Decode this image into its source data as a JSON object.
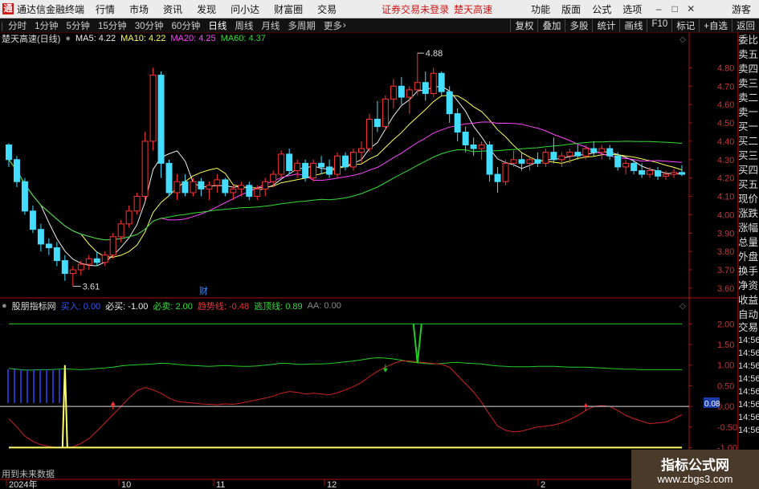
{
  "app": {
    "name": "通达信金融终端",
    "menus": [
      "行情",
      "市场",
      "资讯",
      "发现",
      "问小达",
      "财富圈",
      "交易"
    ],
    "warning": "证券交易未登录",
    "warning2": "楚天高速",
    "functions": [
      "功能",
      "版面",
      "公式",
      "选项"
    ],
    "guest": "游客"
  },
  "periods": [
    "分时",
    "1分钟",
    "5分钟",
    "15分钟",
    "30分钟",
    "60分钟",
    "日线",
    "周线",
    "月线",
    "多周期",
    "更多"
  ],
  "active_period": "日线",
  "tools": [
    "复权",
    "叠加",
    "多股",
    "统计",
    "画线",
    "F10",
    "标记",
    "+自选",
    "返回"
  ],
  "main": {
    "stock_title": "楚天高速(日线)",
    "ma5": "MA5: 4.22",
    "ma10": "MA10: 4.22",
    "ma20": "MA20: 4.25",
    "ma60": "MA60: 4.37",
    "high_label": "4.88",
    "low_label": "3.61",
    "event_label": "财"
  },
  "indicator": {
    "name": "股朋指标网",
    "buy": "买入: 0.00",
    "must_buy": "必买: -1.00",
    "must_sell": "必卖: 2.00",
    "trend": "趋势线: -0.48",
    "escape": "逃顶线: 0.89",
    "aa": "AA: 0.00",
    "cursor_value": "0.08"
  },
  "right_panel": [
    "委比",
    "卖五",
    "卖四",
    "卖三",
    "卖二",
    "卖一",
    "买一",
    "买二",
    "买三",
    "买四",
    "买五",
    "现价",
    "涨跌",
    "涨幅",
    "总量",
    "外盘",
    "换手",
    "净资",
    "收益"
  ],
  "right_panel_lower": [
    "自动",
    "交易",
    "14:56",
    "14:56",
    "14:56",
    "14:56",
    "14:56",
    "14:56",
    "14:56",
    "14:56"
  ],
  "bottom_note": "用到未来数据",
  "watermark": {
    "line1": "指标公式网",
    "line2": "www.zbgs3.com"
  },
  "chart_data": [
    {
      "type": "candlestick",
      "title": "楚天高速(日线)",
      "y_ticks": [
        "4.80",
        "4.70",
        "4.60",
        "4.50",
        "4.40",
        "4.30",
        "4.20",
        "4.10",
        "4.00",
        "3.90",
        "3.80",
        "3.70",
        "3.60"
      ],
      "ylim": [
        3.56,
        4.92
      ],
      "x_ticks": [
        "2024年",
        "10",
        "11",
        "12",
        "2"
      ],
      "candles": [
        [
          4.38,
          4.39,
          4.26,
          4.3
        ],
        [
          4.3,
          4.32,
          4.15,
          4.18
        ],
        [
          4.18,
          4.2,
          4.0,
          4.02
        ],
        [
          4.02,
          4.05,
          3.9,
          3.92
        ],
        [
          3.92,
          3.95,
          3.8,
          3.84
        ],
        [
          3.84,
          3.87,
          3.78,
          3.82
        ],
        [
          3.82,
          3.85,
          3.72,
          3.75
        ],
        [
          3.75,
          3.78,
          3.64,
          3.68
        ],
        [
          3.68,
          3.72,
          3.61,
          3.7
        ],
        [
          3.7,
          3.75,
          3.67,
          3.73
        ],
        [
          3.73,
          3.78,
          3.7,
          3.76
        ],
        [
          3.76,
          3.8,
          3.72,
          3.74
        ],
        [
          3.74,
          3.8,
          3.72,
          3.78
        ],
        [
          3.78,
          3.9,
          3.76,
          3.88
        ],
        [
          3.88,
          3.97,
          3.85,
          3.95
        ],
        [
          3.95,
          4.05,
          3.93,
          4.02
        ],
        [
          4.02,
          4.12,
          4.0,
          4.1
        ],
        [
          4.1,
          4.45,
          4.08,
          4.4
        ],
        [
          4.4,
          4.8,
          4.35,
          4.76
        ],
        [
          4.76,
          4.78,
          4.2,
          4.28
        ],
        [
          4.28,
          4.3,
          4.1,
          4.12
        ],
        [
          4.12,
          4.22,
          4.08,
          4.18
        ],
        [
          4.18,
          4.22,
          4.1,
          4.12
        ],
        [
          4.12,
          4.2,
          4.1,
          4.18
        ],
        [
          4.18,
          4.2,
          4.1,
          4.14
        ],
        [
          4.14,
          4.18,
          4.08,
          4.16
        ],
        [
          4.16,
          4.22,
          4.12,
          4.19
        ],
        [
          4.19,
          4.2,
          4.1,
          4.12
        ],
        [
          4.12,
          4.16,
          4.08,
          4.14
        ],
        [
          4.14,
          4.18,
          4.1,
          4.16
        ],
        [
          4.16,
          4.18,
          4.08,
          4.1
        ],
        [
          4.1,
          4.16,
          4.08,
          4.14
        ],
        [
          4.14,
          4.2,
          4.1,
          4.18
        ],
        [
          4.18,
          4.24,
          4.15,
          4.22
        ],
        [
          4.22,
          4.35,
          4.2,
          4.33
        ],
        [
          4.33,
          4.36,
          4.22,
          4.24
        ],
        [
          4.24,
          4.3,
          4.2,
          4.28
        ],
        [
          4.28,
          4.3,
          4.18,
          4.2
        ],
        [
          4.2,
          4.3,
          4.18,
          4.28
        ],
        [
          4.28,
          4.32,
          4.22,
          4.26
        ],
        [
          4.26,
          4.3,
          4.2,
          4.22
        ],
        [
          4.22,
          4.34,
          4.2,
          4.32
        ],
        [
          4.32,
          4.34,
          4.24,
          4.26
        ],
        [
          4.26,
          4.36,
          4.24,
          4.34
        ],
        [
          4.34,
          4.4,
          4.28,
          4.36
        ],
        [
          4.36,
          4.55,
          4.34,
          4.52
        ],
        [
          4.52,
          4.62,
          4.45,
          4.48
        ],
        [
          4.48,
          4.65,
          4.46,
          4.63
        ],
        [
          4.63,
          4.74,
          4.58,
          4.7
        ],
        [
          4.7,
          4.75,
          4.6,
          4.64
        ],
        [
          4.64,
          4.7,
          4.55,
          4.68
        ],
        [
          4.68,
          4.88,
          4.65,
          4.72
        ],
        [
          4.72,
          4.78,
          4.62,
          4.66
        ],
        [
          4.66,
          4.8,
          4.64,
          4.77
        ],
        [
          4.77,
          4.78,
          4.65,
          4.67
        ],
        [
          4.67,
          4.7,
          4.5,
          4.55
        ],
        [
          4.55,
          4.58,
          4.4,
          4.45
        ],
        [
          4.45,
          4.48,
          4.34,
          4.38
        ],
        [
          4.38,
          4.42,
          4.32,
          4.36
        ],
        [
          4.36,
          4.4,
          4.3,
          4.38
        ],
        [
          4.38,
          4.4,
          4.18,
          4.22
        ],
        [
          4.22,
          4.26,
          4.12,
          4.18
        ],
        [
          4.18,
          4.3,
          4.16,
          4.28
        ],
        [
          4.28,
          4.35,
          4.26,
          4.3
        ],
        [
          4.3,
          4.34,
          4.24,
          4.28
        ],
        [
          4.28,
          4.32,
          4.24,
          4.3
        ],
        [
          4.3,
          4.34,
          4.26,
          4.28
        ],
        [
          4.28,
          4.36,
          4.26,
          4.34
        ],
        [
          4.34,
          4.42,
          4.28,
          4.3
        ],
        [
          4.3,
          4.34,
          4.26,
          4.32
        ],
        [
          4.32,
          4.36,
          4.28,
          4.34
        ],
        [
          4.34,
          4.38,
          4.3,
          4.32
        ],
        [
          4.32,
          4.38,
          4.3,
          4.36
        ],
        [
          4.36,
          4.4,
          4.32,
          4.34
        ],
        [
          4.34,
          4.38,
          4.3,
          4.36
        ],
        [
          4.36,
          4.38,
          4.3,
          4.32
        ],
        [
          4.32,
          4.34,
          4.24,
          4.26
        ],
        [
          4.26,
          4.3,
          4.22,
          4.28
        ],
        [
          4.28,
          4.3,
          4.22,
          4.24
        ],
        [
          4.24,
          4.28,
          4.2,
          4.22
        ],
        [
          4.22,
          4.26,
          4.2,
          4.24
        ],
        [
          4.24,
          4.26,
          4.19,
          4.21
        ],
        [
          4.21,
          4.24,
          4.19,
          4.22
        ],
        [
          4.22,
          4.25,
          4.2,
          4.23
        ],
        [
          4.23,
          4.27,
          4.21,
          4.22
        ]
      ]
    },
    {
      "type": "line",
      "title": "股朋指标网",
      "y_ticks": [
        "2.00",
        "1.50",
        "1.00",
        "0.50",
        "0.00",
        "-0.50",
        "-1.00"
      ],
      "ylim": [
        -1.05,
        2.3
      ],
      "series": [
        {
          "name": "必卖",
          "color": "#22cc22",
          "values": [
            2.0,
            2.0,
            2.0,
            2.0,
            2.0,
            2.0,
            2.0,
            2.0,
            2.0,
            2.0,
            2.0,
            2.0,
            2.0,
            2.0,
            2.0,
            2.0,
            2.0,
            2.0,
            2.0,
            2.0,
            2.0,
            2.0,
            2.0,
            2.0,
            2.0,
            2.0,
            2.0,
            2.0,
            2.0,
            2.0,
            2.0,
            2.0,
            2.0,
            2.0,
            2.0,
            2.0,
            2.0,
            2.0,
            2.0,
            2.0,
            2.0,
            2.0,
            2.0,
            2.0,
            2.0,
            2.0,
            2.0,
            2.0,
            2.0,
            2.0,
            2.0,
            2.0,
            2.0,
            2.0,
            2.0,
            2.0,
            2.0,
            2.0,
            2.0,
            2.0,
            2.0,
            2.0,
            2.0,
            2.0,
            2.0,
            2.0,
            2.0,
            2.0,
            2.0,
            2.0,
            2.0,
            2.0,
            2.0,
            2.0,
            2.0,
            2.0,
            2.0,
            2.0,
            2.0,
            2.0,
            2.0,
            2.0,
            2.0,
            2.0,
            2.0
          ]
        },
        {
          "name": "逃顶线",
          "color": "#22cc22",
          "values": [
            0.92,
            0.9,
            0.88,
            0.88,
            0.89,
            0.89,
            0.9,
            0.91,
            0.9,
            0.89,
            0.9,
            0.92,
            0.93,
            0.95,
            0.98,
            1.0,
            1.01,
            1.02,
            1.03,
            1.05,
            1.04,
            1.02,
            1.0,
            0.99,
            0.98,
            0.97,
            0.98,
            0.99,
            0.98,
            0.97,
            0.97,
            0.98,
            1.0,
            1.02,
            1.05,
            1.04,
            1.02,
            1.02,
            1.03,
            1.03,
            1.04,
            1.06,
            1.08,
            1.1,
            1.13,
            1.16,
            1.18,
            1.17,
            1.15,
            1.12,
            1.08,
            1.06,
            1.04,
            1.03,
            1.04,
            1.06,
            1.07,
            1.05,
            1.04,
            1.03,
            1.0,
            0.98,
            0.97,
            0.96,
            0.96,
            0.96,
            0.97,
            0.97,
            0.97,
            0.96,
            0.95,
            0.95,
            0.95,
            0.94,
            0.93,
            0.92,
            0.91,
            0.9,
            0.9,
            0.89,
            0.89,
            0.89,
            0.89,
            0.89,
            0.89
          ]
        },
        {
          "name": "趋势线",
          "color": "#cc2222",
          "values": [
            -0.3,
            -0.5,
            -0.72,
            -0.85,
            -0.93,
            -0.97,
            -1.0,
            -1.0,
            -0.98,
            -0.9,
            -0.78,
            -0.6,
            -0.4,
            -0.2,
            0.0,
            0.2,
            0.38,
            0.46,
            0.4,
            0.32,
            0.2,
            0.12,
            0.1,
            0.08,
            0.06,
            0.05,
            0.04,
            0.06,
            0.05,
            0.08,
            0.12,
            0.16,
            0.2,
            0.25,
            0.32,
            0.36,
            0.34,
            0.3,
            0.32,
            0.3,
            0.28,
            0.33,
            0.4,
            0.48,
            0.58,
            0.72,
            0.85,
            0.95,
            1.04,
            1.1,
            1.1,
            1.08,
            1.06,
            1.04,
            1.02,
            0.95,
            0.75,
            0.55,
            0.35,
            0.1,
            -0.2,
            -0.48,
            -0.58,
            -0.62,
            -0.6,
            -0.55,
            -0.5,
            -0.48,
            -0.45,
            -0.4,
            -0.32,
            -0.22,
            -0.1,
            0.0,
            0.02,
            0.0,
            -0.1,
            -0.22,
            -0.3,
            -0.36,
            -0.42,
            -0.4,
            -0.38,
            -0.3,
            -0.2
          ]
        },
        {
          "name": "必买",
          "color": "#ffff66",
          "values": [
            -1.0,
            -1.0,
            -1.0,
            -1.0,
            -1.0,
            -1.0,
            -1.0,
            -1.0,
            -1.0,
            -1.0,
            -1.0,
            -1.0,
            -1.0,
            -1.0,
            -1.0,
            -1.0,
            -1.0,
            -1.0,
            -1.0,
            -1.0,
            -1.0,
            -1.0,
            -1.0,
            -1.0,
            -1.0,
            -1.0,
            -1.0,
            -1.0,
            -1.0,
            -1.0,
            -1.0,
            -1.0,
            -1.0,
            -1.0,
            -1.0,
            -1.0,
            -1.0,
            -1.0,
            -1.0,
            -1.0,
            -1.0,
            -1.0,
            -1.0,
            -1.0,
            -1.0,
            -1.0,
            -1.0,
            -1.0,
            -1.0,
            -1.0,
            -1.0,
            -1.0,
            -1.0,
            -1.0,
            -1.0,
            -1.0,
            -1.0,
            -1.0,
            -1.0,
            -1.0,
            -1.0,
            -1.0,
            -1.0,
            -1.0,
            -1.0,
            -1.0,
            -1.0,
            -1.0,
            -1.0,
            -1.0,
            -1.0,
            -1.0,
            -1.0,
            -1.0,
            -1.0,
            -1.0,
            -1.0,
            -1.0,
            -1.0,
            -1.0,
            -1.0,
            -1.0,
            -1.0,
            -1.0,
            -1.0
          ]
        }
      ]
    }
  ]
}
